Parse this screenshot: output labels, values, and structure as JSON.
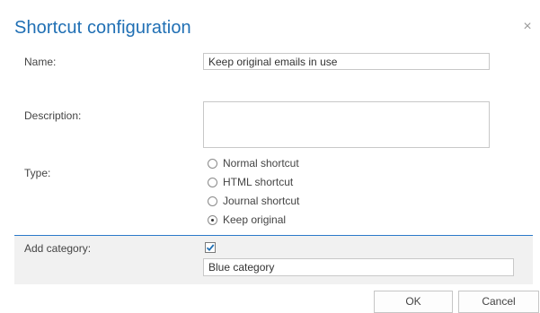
{
  "dialog": {
    "title": "Shortcut configuration",
    "close_glyph": "×"
  },
  "fields": {
    "name_label": "Name:",
    "name_value": "Keep original emails in use",
    "description_label": "Description:",
    "description_value": "",
    "type_label": "Type:",
    "type_options": [
      {
        "label": "Normal shortcut",
        "checked": false
      },
      {
        "label": "HTML shortcut",
        "checked": false
      },
      {
        "label": "Journal shortcut",
        "checked": false
      },
      {
        "label": "Keep original",
        "checked": true
      }
    ],
    "add_category_label": "Add category:",
    "add_category_checked": true,
    "category_value": "Blue category"
  },
  "buttons": {
    "ok": "OK",
    "cancel": "Cancel"
  },
  "colors": {
    "title": "#1f6fb4",
    "accent_border": "#2b7ac9",
    "band_bg": "#f1f1f1"
  }
}
